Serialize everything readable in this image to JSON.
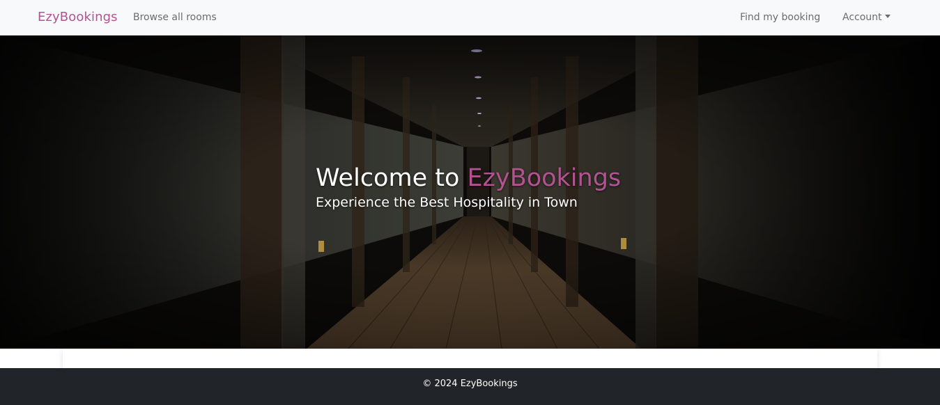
{
  "navbar": {
    "brand": "EzyBookings",
    "links": {
      "browse": "Browse all rooms",
      "find_booking": "Find my booking",
      "account": "Account"
    }
  },
  "hero": {
    "title_prefix": "Welcome to ",
    "title_brand": "EzyBookings",
    "subtitle": "Experience the Best Hospitality in Town"
  },
  "footer": {
    "copyright": "© 2024 EzyBookings"
  },
  "colors": {
    "brand_accent": "#b0538f",
    "navbar_bg": "#f8f9fa",
    "footer_bg": "#212529"
  },
  "icons": {
    "account_dropdown": "caret-down-icon"
  }
}
